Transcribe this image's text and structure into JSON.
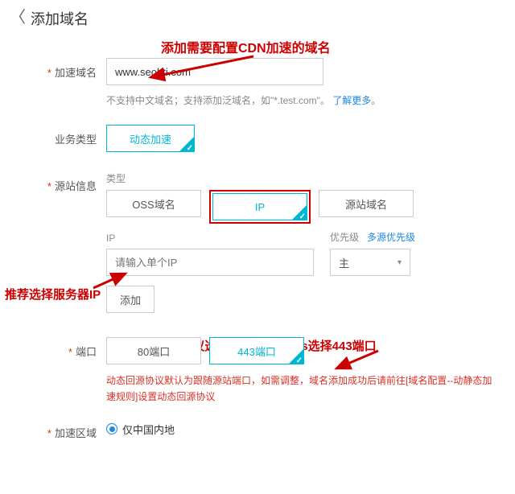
{
  "page": {
    "title": "添加域名"
  },
  "annotations": {
    "a1": "添加需要配置CDN加速的域名",
    "a2": "推荐选择服务器IP",
    "a3": "http协议选择80端口，https选择443端口"
  },
  "domain": {
    "label": "加速域名",
    "value": "www.seobti.com",
    "help_pre": "不支持中文域名；支持添加泛域名，如\"*.test.com\"。",
    "help_link": "了解更多",
    "help_suf": "。"
  },
  "biz": {
    "label": "业务类型",
    "selected": "动态加速"
  },
  "origin": {
    "label": "源站信息",
    "type_label": "类型",
    "opts": {
      "oss": "OSS域名",
      "ip": "IP",
      "domain": "源站域名"
    },
    "ip_label": "IP",
    "ip_placeholder": "请输入单个IP",
    "priority_label": "优先级",
    "priority_link": "多源优先级",
    "priority_value": "主",
    "add_btn": "添加"
  },
  "port": {
    "label": "端口",
    "p80": "80端口",
    "p443": "443端口",
    "note": "动态回源协议默认为跟随源站端口，如需调整，域名添加成功后请前往[域名配置--动静态加速规则]设置动态回源协议"
  },
  "region": {
    "label": "加速区域",
    "opt1": "仅中国内地"
  }
}
